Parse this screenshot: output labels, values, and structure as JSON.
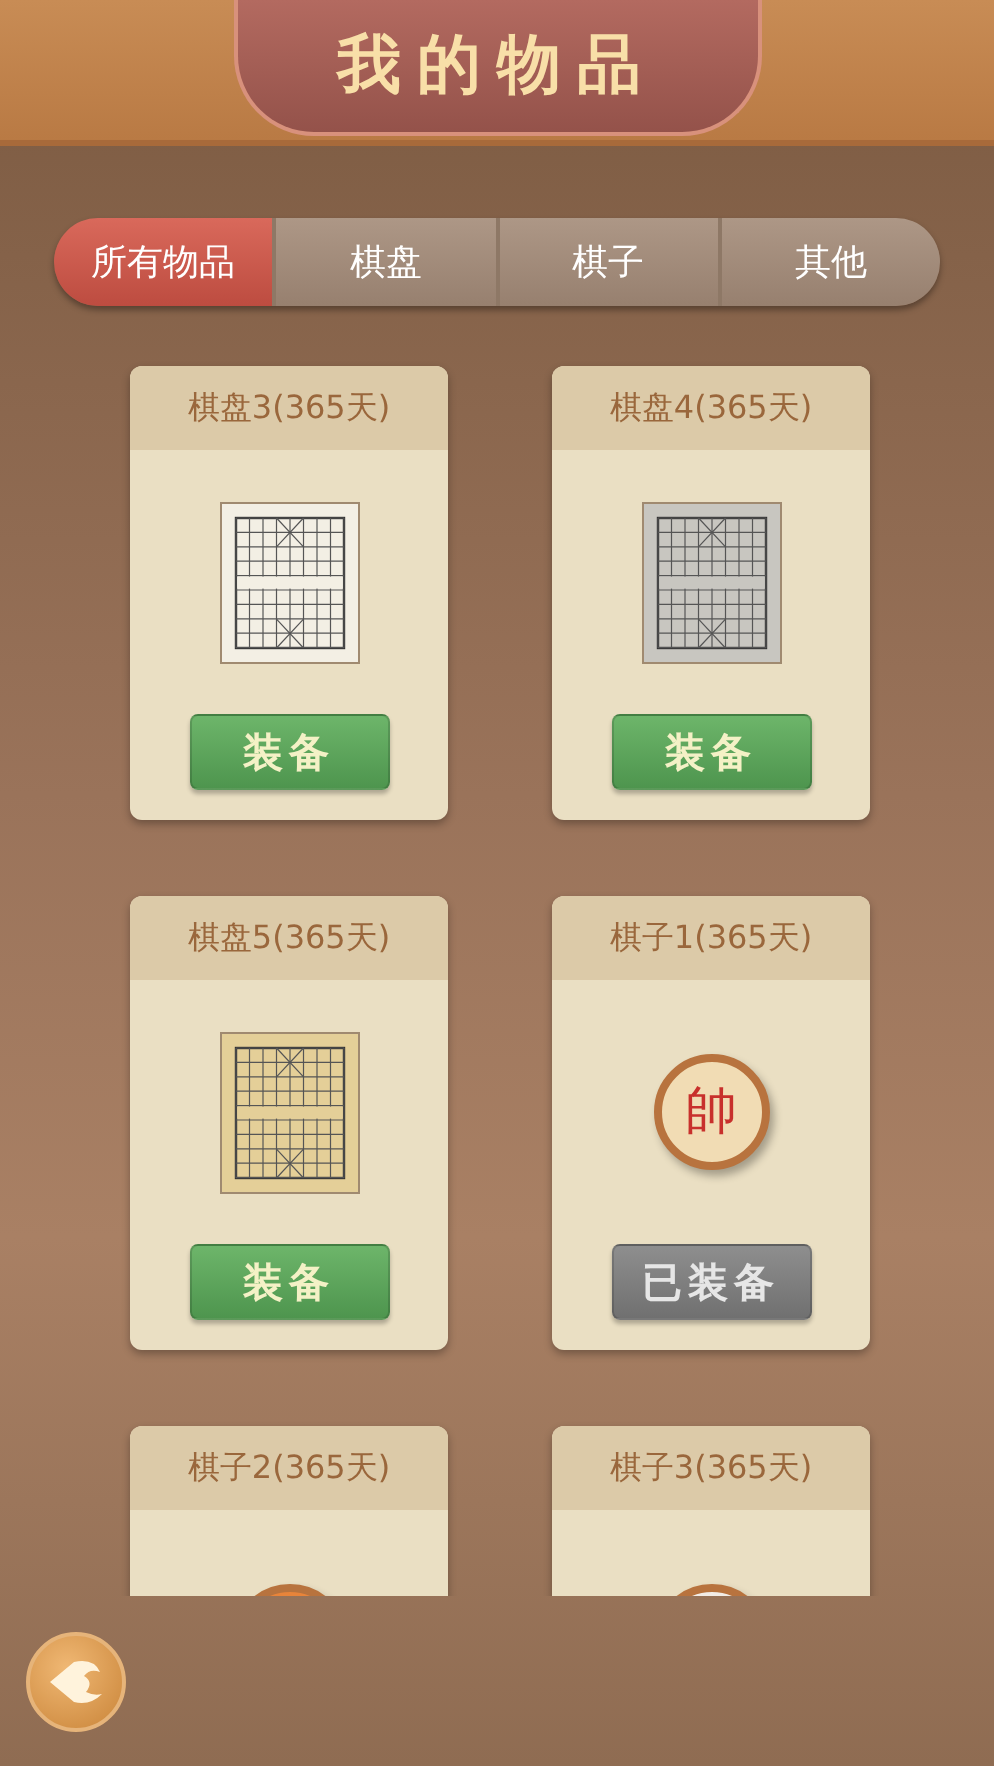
{
  "header": {
    "title": "我的物品"
  },
  "tabs": [
    {
      "label": "所有物品",
      "selected": true
    },
    {
      "label": "棋盘",
      "selected": false
    },
    {
      "label": "棋子",
      "selected": false
    },
    {
      "label": "其他",
      "selected": false
    }
  ],
  "items": [
    {
      "name": "棋盘3(365天)",
      "kind": "board",
      "color": "#f3efe4",
      "button": {
        "label": "装备",
        "equipped": false
      }
    },
    {
      "name": "棋盘4(365天)",
      "kind": "board",
      "color": "#c8c6c0",
      "button": {
        "label": "装备",
        "equipped": false
      }
    },
    {
      "name": "棋盘5(365天)",
      "kind": "board",
      "color": "#e4cf98",
      "button": {
        "label": "装备",
        "equipped": false
      }
    },
    {
      "name": "棋子1(365天)",
      "kind": "piece",
      "color": "#f1dcb4",
      "glyph": "帥",
      "button": {
        "label": "已装备",
        "equipped": true
      }
    },
    {
      "name": "棋子2(365天)",
      "kind": "piece",
      "color": "#e8843a"
    },
    {
      "name": "棋子3(365天)",
      "kind": "piece",
      "color": "#f2ece6"
    }
  ]
}
